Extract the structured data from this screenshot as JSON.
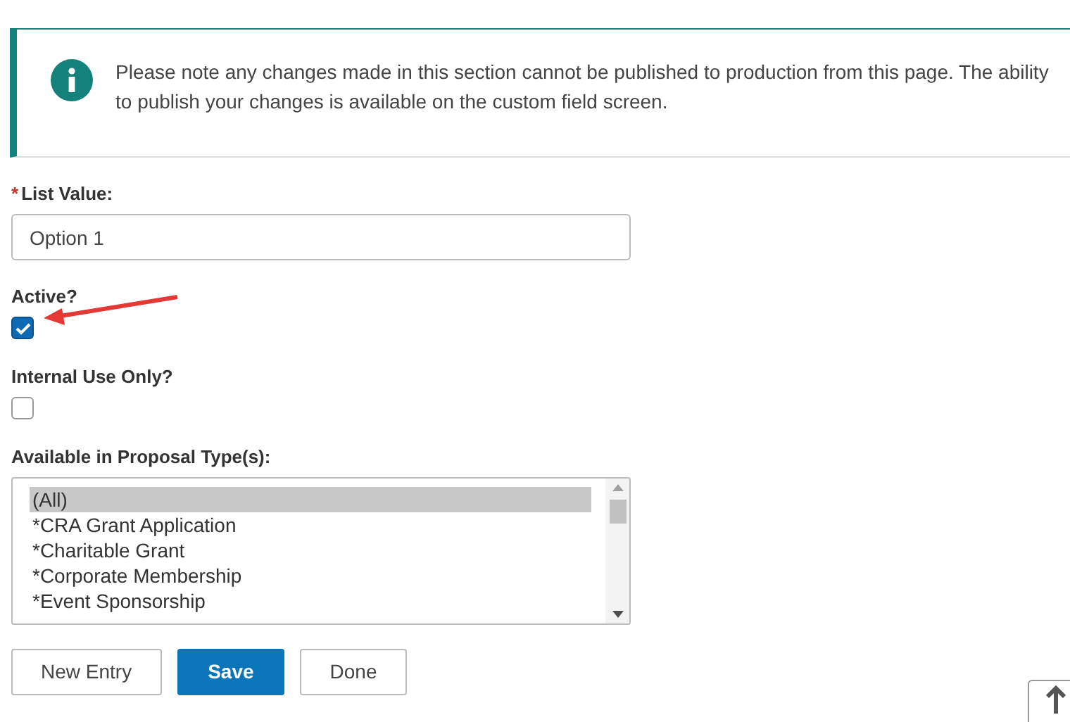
{
  "notice": {
    "text": "Please note any changes made in this section cannot be published to production from this page. The ability to publish your changes is available on the custom field screen."
  },
  "fields": [
    {
      "kind": "text",
      "label": "List Value:",
      "required": true,
      "value": "Option 1"
    },
    {
      "kind": "checkbox",
      "label": "Active?",
      "required": false,
      "checked": true
    },
    {
      "kind": "checkbox",
      "label": "Internal Use Only?",
      "required": false,
      "checked": false
    },
    {
      "kind": "listbox",
      "label": "Available in Proposal Type(s):",
      "required": false,
      "options": [
        {
          "label": "(All)",
          "selected": true
        },
        {
          "label": "*CRA Grant Application",
          "selected": false
        },
        {
          "label": "*Charitable Grant",
          "selected": false
        },
        {
          "label": "*Corporate Membership",
          "selected": false
        },
        {
          "label": "*Event Sponsorship",
          "selected": false
        }
      ]
    }
  ],
  "required_mark": "*",
  "buttons": [
    {
      "label": "New Entry",
      "kind": "secondary"
    },
    {
      "label": "Save",
      "kind": "primary"
    },
    {
      "label": "Done",
      "kind": "secondary"
    }
  ]
}
